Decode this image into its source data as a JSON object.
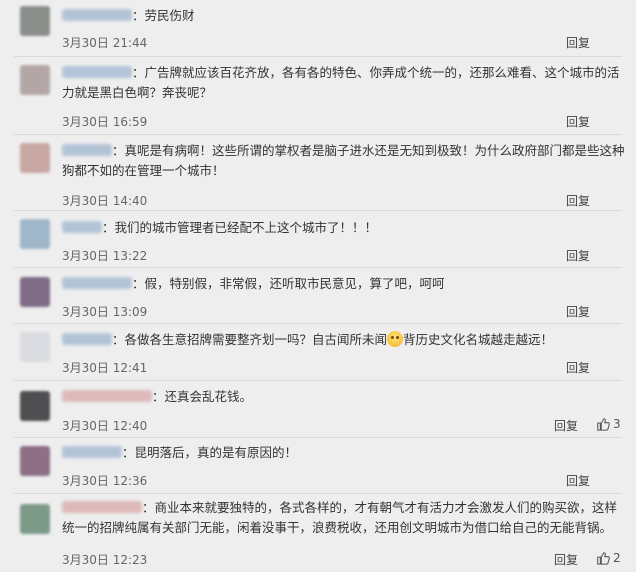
{
  "comments": [
    {
      "text": "：劳民伤财",
      "time": "3月30日 21:44",
      "reply": "回复",
      "likes": "",
      "user_w": 70,
      "avatar": "#8a8f8b"
    },
    {
      "text": "：广告牌就应该百花齐放，各有各的特色、你弄成个统一的，还那么难看、这个城市的活力就是黑白色啊？奔丧呢？",
      "time": "3月30日 16:59",
      "reply": "回复",
      "likes": "",
      "user_w": 70,
      "avatar": "#b3a7a6"
    },
    {
      "text": "：真呢是有病啊！这些所谓的掌权者是脑子进水还是无知到极致！为什么政府部门都是些这种狗都不如的在管理一个城市！",
      "time": "3月30日 14:40",
      "reply": "回复",
      "likes": "",
      "user_w": 50,
      "avatar": "#c9a8a4"
    },
    {
      "text": "：我们的城市管理者已经配不上这个城市了！！！",
      "time": "3月30日 13:22",
      "reply": "回复",
      "likes": "",
      "user_w": 40,
      "avatar": "#9fb7c9"
    },
    {
      "text": "：假，特别假，非常假，还听取市民意见，算了吧，呵呵",
      "time": "3月30日 13:09",
      "reply": "回复",
      "likes": "",
      "user_w": 70,
      "avatar": "#7f6b86"
    },
    {
      "text": "：各做各生意招牌需要整齐划一吗？自古闻所未闻",
      "text2": "背历史文化名城越走越远！",
      "time": "3月30日 12:41",
      "reply": "回复",
      "likes": "",
      "user_w": 50,
      "avatar": "#d9dbe0"
    },
    {
      "text": "：还真会乱花钱。",
      "time": "3月30日 12:40",
      "reply": "回复",
      "likes": "3",
      "user_w": 90,
      "avatar": "#4f4f52"
    },
    {
      "text": "：昆明落后，真的是有原因的！",
      "time": "3月30日 12:36",
      "reply": "回复",
      "likes": "",
      "user_w": 60,
      "avatar": "#8d6f86"
    },
    {
      "text": "：商业本来就要独特的，各式各样的，才有朝气才有活力才会激发人们的购买欲，这样统一的招牌纯属有关部门无能，闲着没事干，浪费税收，还用创文明城市为借口给自己的无能背锅。",
      "time": "3月30日 12:23",
      "reply": "回复",
      "likes": "2",
      "user_w": 80,
      "avatar": "#7d9a88"
    }
  ]
}
